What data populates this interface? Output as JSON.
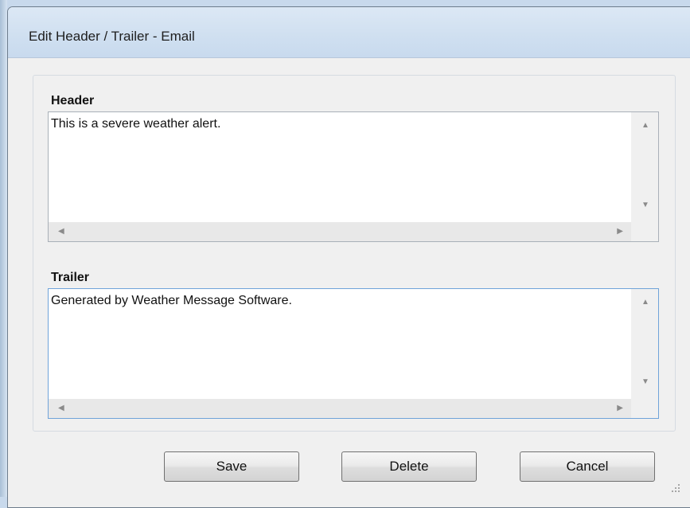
{
  "window": {
    "title": "Edit Header / Trailer - Email"
  },
  "header_section": {
    "label": "Header",
    "text": "This is a severe weather alert."
  },
  "trailer_section": {
    "label": "Trailer",
    "text": "Generated by Weather Message Software."
  },
  "buttons": {
    "save": "Save",
    "delete": "Delete",
    "cancel": "Cancel"
  },
  "icons": {
    "scroll_up": "scroll-up-arrow",
    "scroll_down": "scroll-down-arrow",
    "scroll_left": "scroll-left-arrow",
    "scroll_right": "scroll-right-arrow",
    "resize_grip": "resize-grip"
  }
}
